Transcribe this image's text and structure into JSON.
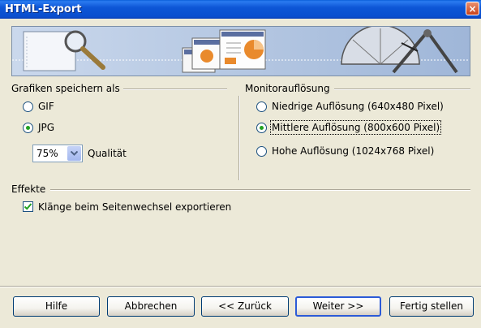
{
  "window": {
    "title": "HTML-Export",
    "close_symbol": "×"
  },
  "graphics": {
    "heading": "Grafiken speichern als",
    "options": [
      {
        "label": "GIF",
        "selected": false
      },
      {
        "label": "JPG",
        "selected": true
      }
    ],
    "quality_value": "75%",
    "quality_label": "Qualität"
  },
  "monitor": {
    "heading": "Monitorauflösung",
    "options": [
      {
        "label": "Niedrige Auflösung (640x480 Pixel)",
        "selected": false
      },
      {
        "label": "Mittlere Auflösung (800x600 Pixel)",
        "selected": true
      },
      {
        "label": "Hohe Auflösung (1024x768 Pixel)",
        "selected": false
      }
    ]
  },
  "effects": {
    "heading": "Effekte",
    "checkbox_label": "Klänge beim Seitenwechsel exportieren",
    "checkbox_checked": true
  },
  "buttons": {
    "help": "Hilfe",
    "cancel": "Abbrechen",
    "back": "<< Zurück",
    "next": "Weiter >>",
    "finish": "Fertig stellen"
  },
  "colors": {
    "titlebar": "#0a4fcf",
    "dialog_bg": "#ece9d8",
    "radio_dot": "#21a121",
    "check_mark": "#21a121"
  }
}
